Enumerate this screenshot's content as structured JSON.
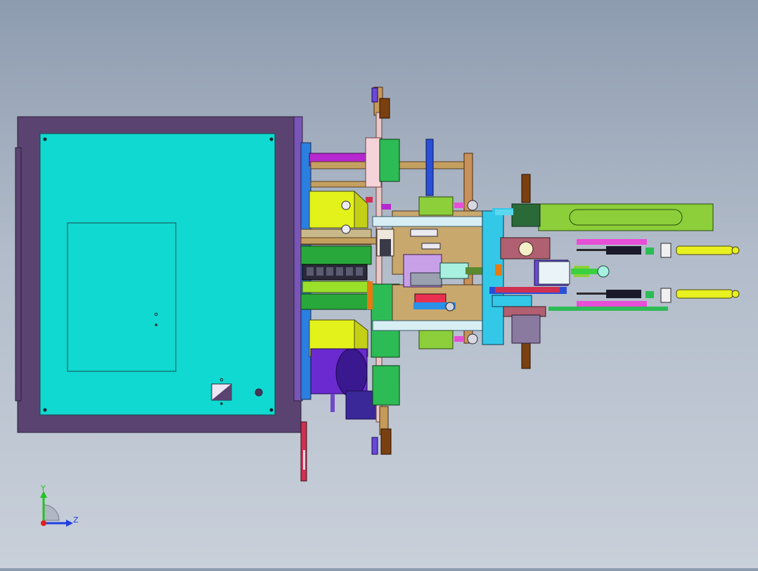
{
  "triad": {
    "y_label": "Y",
    "z_label": "Z",
    "colors": {
      "y": "#22c322",
      "z": "#1f3fe0",
      "x": "#e02020"
    }
  },
  "palette": {
    "background_top": "#8e9cb0",
    "background_bottom": "#c9d0da",
    "frame": "#5a4370",
    "panel": "#0fd9d0",
    "yellow": "#e3f21a",
    "green": "#2dbb55",
    "lime": "#8ccf3a",
    "cyan": "#33c8e8",
    "magenta": "#e64fd6",
    "tan": "#c9a86e",
    "purple": "#6a2ad0",
    "red": "#d03050",
    "blue": "#2a4fd8"
  }
}
